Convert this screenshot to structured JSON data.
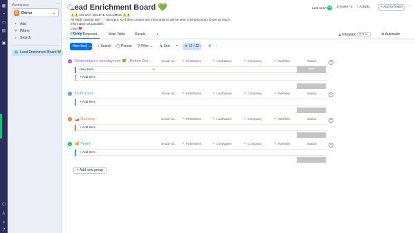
{
  "workspace": {
    "label": "Workspace",
    "badge": "D",
    "name": "Démo",
    "nav": [
      {
        "icon": "plus-icon",
        "glyph": "+",
        "label": "Add"
      },
      {
        "icon": "filter-icon",
        "glyph": "⚲",
        "label": "Filters"
      },
      {
        "icon": "search-icon",
        "glyph": "⌕",
        "label": "Search"
      }
    ],
    "board_item": "Lead Enrichment Board 💚"
  },
  "board": {
    "title": "Lead Enrichment Board 💚",
    "description_line1": "⚠️⚠️ DO NOT DELETE COLUMNS ⚠️⚠️",
    "description_line2": "All fields starting with \"_\" are input, so if they contain any information it will be sent to DropContact to get as much information as possible.",
    "description_line3": "Love ❤️",
    "see_more": "See More"
  },
  "topbar": {
    "last_seen": "Last seen",
    "avatar": "DB",
    "invite": "Invite / 1",
    "activity": "Activity",
    "add_to_board": "+ Add to board"
  },
  "tabs": {
    "items": [
      "Setup Dropcont...",
      "Main Table",
      "Result..."
    ],
    "add": "+",
    "integrate": "Integrate",
    "automate": "Automate"
  },
  "toolbar": {
    "new_item": "New Item",
    "search": "Search",
    "person": "Person",
    "filter": "Filter",
    "sort": "Sort",
    "cols": "12 / 22"
  },
  "columns": [
    "Souar-Id...",
    "FirstName",
    "LastName",
    "Company",
    "Website",
    "Status"
  ],
  "groups": [
    {
      "name": "Dropcontact x monday.com 💚 - Before Dro...",
      "color": "#a25ddc",
      "item": "New Item",
      "status": "New",
      "add_item": "+ Add Item"
    },
    {
      "name": "To Process",
      "color": "#579bfc",
      "item": "",
      "status": "",
      "add_item": "+ Add Item"
    },
    {
      "name": "🏎️ Running",
      "color": "#ff7a3d",
      "item": "",
      "status": "",
      "add_item": "+ Add Item"
    },
    {
      "name": "🥳 Yeah!",
      "color": "#00c875",
      "item": "",
      "status": "",
      "add_item": "+ Add Item"
    }
  ],
  "add_group": "+ Add new group"
}
